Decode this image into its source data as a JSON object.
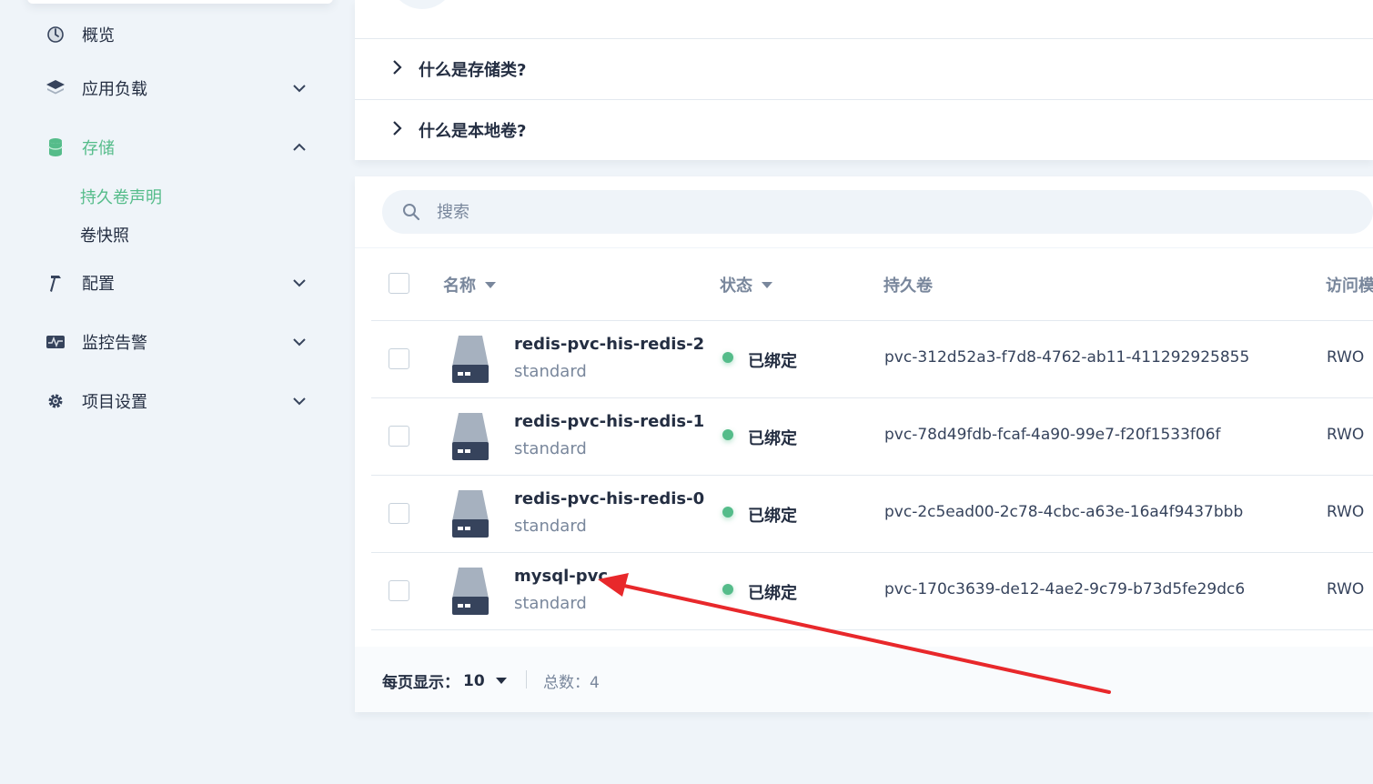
{
  "sidebar": {
    "items": [
      {
        "label": "概览",
        "icon": "dashboard-icon",
        "expanded": null
      },
      {
        "label": "应用负载",
        "icon": "layers-icon",
        "expanded": false
      },
      {
        "label": "存储",
        "icon": "database-icon",
        "expanded": true,
        "active": true,
        "children": [
          {
            "label": "持久卷声明",
            "active": true
          },
          {
            "label": "卷快照",
            "active": false
          }
        ]
      },
      {
        "label": "配置",
        "icon": "hammer-icon",
        "expanded": false
      },
      {
        "label": "监控告警",
        "icon": "monitor-chart-icon",
        "expanded": false
      },
      {
        "label": "项目设置",
        "icon": "gear-icon",
        "expanded": false
      }
    ]
  },
  "faq": {
    "items": [
      {
        "label": "什么是存储类?"
      },
      {
        "label": "什么是本地卷?"
      }
    ]
  },
  "search": {
    "placeholder": "搜索",
    "value": ""
  },
  "table": {
    "columns": {
      "name": "名称",
      "status": "状态",
      "volume": "持久卷",
      "access": "访问模"
    },
    "rows": [
      {
        "name": "redis-pvc-his-redis-2",
        "storage_class": "standard",
        "status": "已绑定",
        "volume": "pvc-312d52a3-f7d8-4762-ab11-411292925855",
        "access": "RWO"
      },
      {
        "name": "redis-pvc-his-redis-1",
        "storage_class": "standard",
        "status": "已绑定",
        "volume": "pvc-78d49fdb-fcaf-4a90-99e7-f20f1533f06f",
        "access": "RWO"
      },
      {
        "name": "redis-pvc-his-redis-0",
        "storage_class": "standard",
        "status": "已绑定",
        "volume": "pvc-2c5ead00-2c78-4cbc-a63e-16a4f9437bbb",
        "access": "RWO"
      },
      {
        "name": "mysql-pvc",
        "storage_class": "standard",
        "status": "已绑定",
        "volume": "pvc-170c3639-de12-4ae2-9c79-b73d5fe29dc6",
        "access": "RWO"
      }
    ]
  },
  "footer": {
    "page_size_label": "每页显示：",
    "page_size_value": "10",
    "total_label": "总数：4"
  },
  "colors": {
    "accent": "#55bc8a",
    "text": "#242e42",
    "muted": "#79879c",
    "background": "#eff4f9",
    "annotation_arrow": "#e8282b"
  }
}
